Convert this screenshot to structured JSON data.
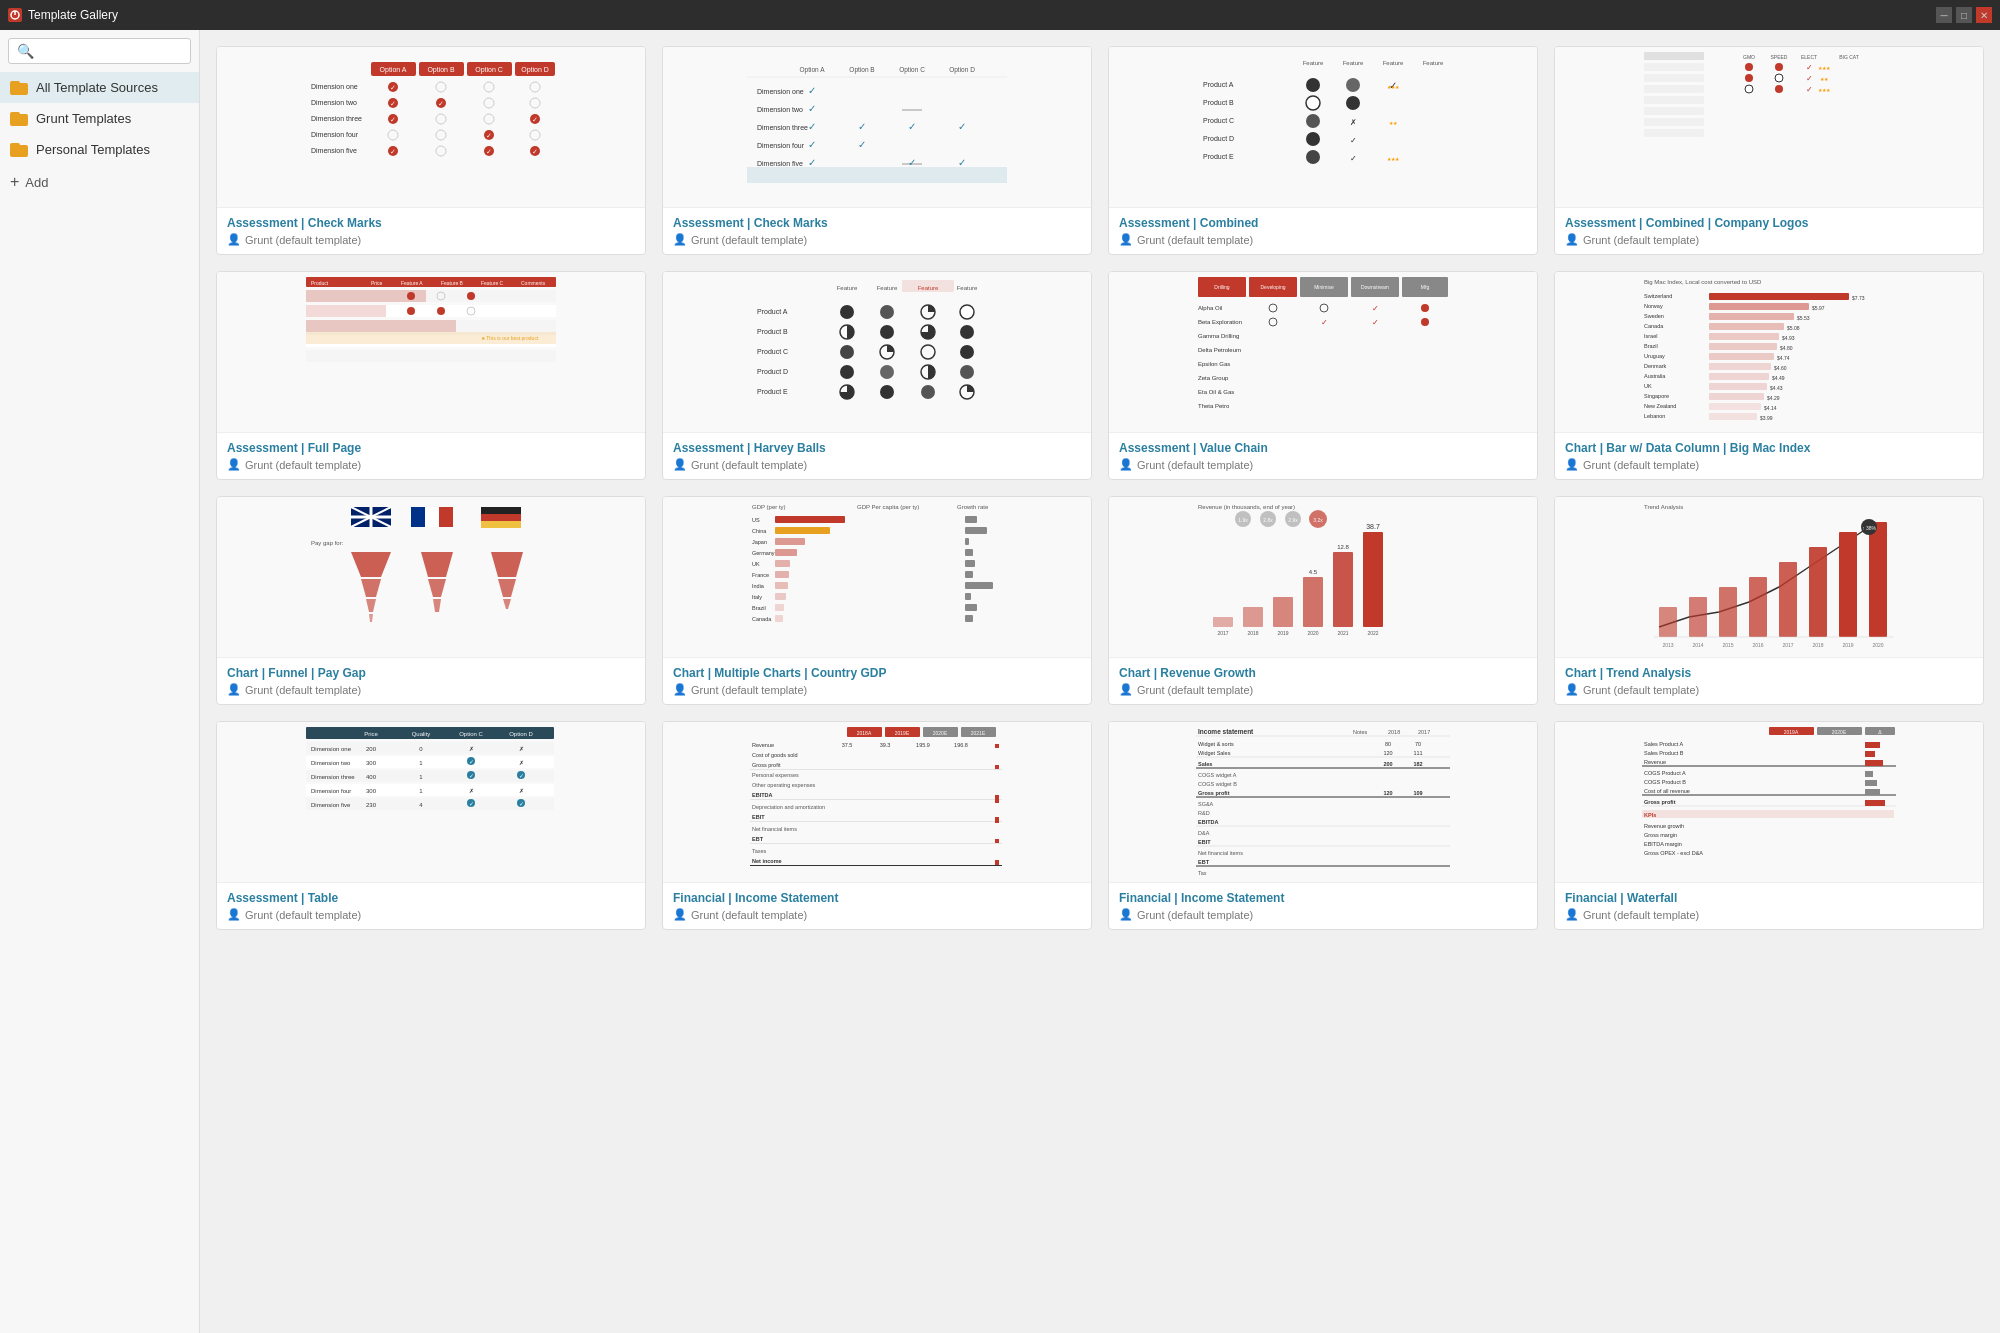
{
  "titleBar": {
    "title": "Template Gallery",
    "controls": [
      "minimize",
      "maximize",
      "close"
    ]
  },
  "sidebar": {
    "searchPlaceholder": "Search...",
    "items": [
      {
        "id": "all",
        "label": "All Template Sources",
        "icon": "folder",
        "active": true
      },
      {
        "id": "grunt",
        "label": "Grunt Templates",
        "icon": "folder"
      },
      {
        "id": "personal",
        "label": "Personal Templates",
        "icon": "folder"
      }
    ],
    "addLabel": "Add"
  },
  "gallery": {
    "templates": [
      {
        "id": "t1",
        "title": "Assessment | Check Marks",
        "author": "Grunt (default template)",
        "type": "check-marks-orange"
      },
      {
        "id": "t2",
        "title": "Assessment | Check Marks",
        "author": "Grunt (default template)",
        "type": "check-marks-teal"
      },
      {
        "id": "t3",
        "title": "Assessment | Combined",
        "author": "Grunt (default template)",
        "type": "combined"
      },
      {
        "id": "t4",
        "title": "Assessment | Combined | Company Logos",
        "author": "Grunt (default template)",
        "type": "combined-logos"
      },
      {
        "id": "t5",
        "title": "Assessment | Full Page",
        "author": "Grunt (default template)",
        "type": "full-page"
      },
      {
        "id": "t6",
        "title": "Assessment | Harvey Balls",
        "author": "Grunt (default template)",
        "type": "harvey-balls"
      },
      {
        "id": "t7",
        "title": "Assessment | Value Chain",
        "author": "Grunt (default template)",
        "type": "value-chain"
      },
      {
        "id": "t8",
        "title": "Chart | Bar w/ Data Column | Big Mac Index",
        "author": "Grunt (default template)",
        "type": "big-mac"
      },
      {
        "id": "t9",
        "title": "Chart | Funnel | Pay Gap",
        "author": "Grunt (default template)",
        "type": "funnel"
      },
      {
        "id": "t10",
        "title": "Chart | Multiple Charts | Country GDP",
        "author": "Grunt (default template)",
        "type": "country-gdp"
      },
      {
        "id": "t11",
        "title": "Chart | Revenue Growth",
        "author": "Grunt (default template)",
        "type": "revenue-growth"
      },
      {
        "id": "t12",
        "title": "Chart | Trend Analysis",
        "author": "Grunt (default template)",
        "type": "trend-analysis"
      },
      {
        "id": "t13",
        "title": "Assessment | Table",
        "author": "Grunt (default template)",
        "type": "table-dark"
      },
      {
        "id": "t14",
        "title": "Financial | Income Statement",
        "author": "Grunt (default template)",
        "type": "financial-cols"
      },
      {
        "id": "t15",
        "title": "Financial | Income Statement",
        "author": "Grunt (default template)",
        "type": "financial-plain"
      },
      {
        "id": "t16",
        "title": "Financial | Waterfall",
        "author": "Grunt (default template)",
        "type": "waterfall"
      }
    ]
  },
  "colors": {
    "accent": "#c0392b",
    "teal": "#2a7fa0",
    "orange": "#e8a020"
  }
}
